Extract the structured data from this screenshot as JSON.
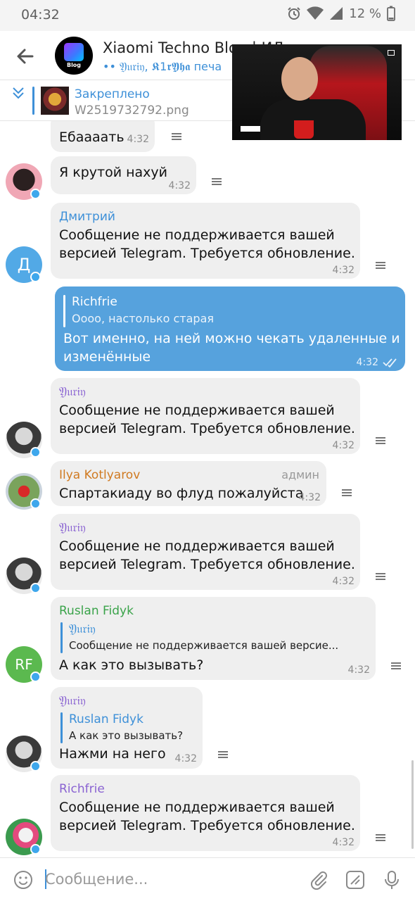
{
  "status_bar": {
    "time": "04:32",
    "battery": "12 %"
  },
  "header": {
    "title": "Xiaomi Techno Blog | ИЛ",
    "subtitle": "•• 𝔜𝔲𝔯𝔦𝔶, 𝕶1𝖗𝖄𝖍𝖆 печа",
    "avatar_label": "Blog"
  },
  "pinned": {
    "title": "Закреплено",
    "text": "W2519732792.png"
  },
  "messages": [
    {
      "text": "Ебаааать",
      "time": "4:32"
    },
    {
      "text": "Я крутой нахуй",
      "time": "4:32"
    },
    {
      "sender": "Дмитрий",
      "avatar_letter": "Д",
      "line1": "Сообщение не поддерживается вашей",
      "line2": "версией Telegram. Требуется обновление.",
      "time": "4:32"
    },
    {
      "quote_name": "Richfrie",
      "quote_text": "Оооо, настолько старая",
      "line1": "Вот именно, на ней можно чекать удаленные и",
      "line2": "изменённые",
      "time": "4:32"
    },
    {
      "sender": "𝔜𝔲𝔯𝔦𝔶",
      "line1": "Сообщение не поддерживается вашей",
      "line2": "версией Telegram. Требуется обновление.",
      "time": "4:32"
    },
    {
      "sender": "Ilya Kotlyarov",
      "role": "админ",
      "text": "Спартакиаду во флуд пожалуйста",
      "time": "4:32"
    },
    {
      "sender": "𝔜𝔲𝔯𝔦𝔶",
      "line1": "Сообщение не поддерживается вашей",
      "line2": "версией Telegram. Требуется обновление.",
      "time": "4:32"
    },
    {
      "sender": "Ruslan Fidyk",
      "avatar_letter": "RF",
      "quote_name": "𝔜𝔲𝔯𝔦𝔶",
      "quote_text": "Сообщение не поддерживается вашей версие...",
      "text": "А как это вызывать?",
      "time": "4:32"
    },
    {
      "sender": "𝔜𝔲𝔯𝔦𝔶",
      "quote_name": "Ruslan Fidyk",
      "quote_text": "А как это вызывать?",
      "text": "Нажми на него",
      "time": "4:32"
    },
    {
      "sender": "Richfrie",
      "line1": "Сообщение не поддерживается вашей",
      "line2": "версией Telegram. Требуется обновление.",
      "time": "4:32"
    }
  ],
  "input": {
    "placeholder": "Сообщение..."
  },
  "colors": {
    "accent": "#3e90d8",
    "outgoing_bubble": "#56a2dd",
    "incoming_bubble": "#efefef",
    "name_green": "#3aa34a",
    "name_orange": "#d07a21",
    "name_purple": "#8a63d2",
    "online_dot": "#3ea7ec"
  },
  "icons": [
    "back-arrow-icon",
    "alarm-icon",
    "wifi-icon",
    "signal-icon",
    "battery-icon",
    "chevrons-down-icon",
    "menu-icon",
    "emoji-icon",
    "attach-icon",
    "sticker-icon",
    "mic-icon",
    "read-checks-icon"
  ]
}
